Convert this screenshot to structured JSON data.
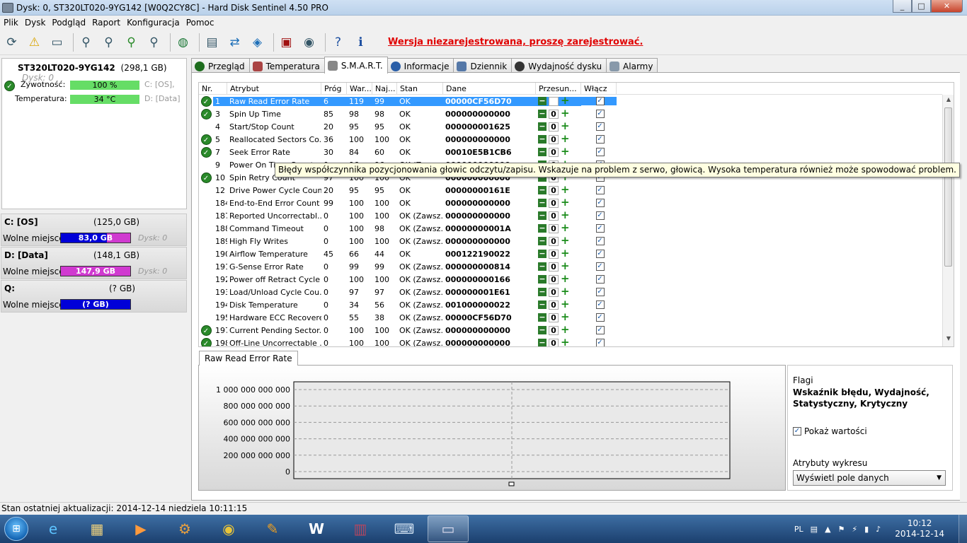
{
  "window": {
    "title": "Dysk: 0, ST320LT020-9YG142 [W0Q2CY8C]  -  Hard Disk Sentinel 4.50 PRO",
    "minimize": "_",
    "maximize": "□",
    "close": "✕"
  },
  "menu": [
    "Plik",
    "Dysk",
    "Podgląd",
    "Raport",
    "Konfiguracja",
    "Pomoc"
  ],
  "toolbar": {
    "icons": [
      "refresh-icon",
      "alert-icon",
      "disk-icon",
      "disk-tool-1-icon",
      "disk-tool-2-icon",
      "disk-tool-3-icon",
      "disk-tool-4-icon",
      "globe-icon",
      "document-icon",
      "sync-icon",
      "network-icon",
      "report-icon",
      "speaker-icon",
      "help-icon",
      "info-icon"
    ],
    "notice": "Wersja niezarejestrowana, proszę zarejestrować."
  },
  "disk": {
    "name": "ST320LT020-9YG142",
    "size": "(298,1 GB)",
    "dnum": "Dysk: 0",
    "health_label": "Żywotność:",
    "health_value": "100 %",
    "health_pct": 100,
    "health_part": "C: [OS],",
    "temp_label": "Temperatura:",
    "temp_value": "34 °C",
    "temp_part": "D: [Data]"
  },
  "partitions": [
    {
      "name": "C: [OS]",
      "size": "(125,0 GB)",
      "free_label": "Wolne miejsce",
      "free": "83,0 GB",
      "used_fraction": 0.34,
      "disk": "Dysk: 0"
    },
    {
      "name": "D: [Data]",
      "size": "(148,1 GB)",
      "free_label": "Wolne miejsce",
      "free": "147,9 GB",
      "used_fraction": 1.0,
      "disk": "Dysk: 0"
    },
    {
      "name": "Q:",
      "size": "(? GB)",
      "free_label": "Wolne miejsce",
      "free": "(? GB)",
      "used_fraction": 0,
      "disk": ""
    }
  ],
  "tabs": [
    "Przegląd",
    "Temperatura",
    "S.M.A.R.T.",
    "Informacje",
    "Dziennik",
    "Wydajność dysku",
    "Alarmy"
  ],
  "active_tab": "S.M.A.R.T.",
  "smart": {
    "headers": [
      "Nr.",
      "Atrybut",
      "Próg",
      "War...",
      "Naj...",
      "Stan",
      "Dane",
      "Przesun...",
      "Włącz"
    ],
    "rows": [
      {
        "ok": true,
        "nr": "1",
        "attr": "Raw Read Error Rate",
        "thr": "6",
        "val": "119",
        "worst": "99",
        "stan": "OK",
        "data": "00000CF56D70",
        "offset": "0",
        "sel": true
      },
      {
        "ok": true,
        "nr": "3",
        "attr": "Spin Up Time",
        "thr": "85",
        "val": "98",
        "worst": "98",
        "stan": "OK",
        "data": "000000000000",
        "offset": "0"
      },
      {
        "ok": false,
        "nr": "4",
        "attr": "Start/Stop Count",
        "thr": "20",
        "val": "95",
        "worst": "95",
        "stan": "OK",
        "data": "000000001625",
        "offset": "0"
      },
      {
        "ok": true,
        "nr": "5",
        "attr": "Reallocated Sectors Co...",
        "thr": "36",
        "val": "100",
        "worst": "100",
        "stan": "OK",
        "data": "000000000000",
        "offset": "0"
      },
      {
        "ok": true,
        "nr": "7",
        "attr": "Seek Error Rate",
        "thr": "30",
        "val": "84",
        "worst": "60",
        "stan": "OK",
        "data": "00010E5B1CB6",
        "offset": "0"
      },
      {
        "ok": false,
        "nr": "9",
        "attr": "Power On Time Count",
        "thr": "0",
        "val": "96",
        "worst": "96",
        "stan": "OK (Zawsz...",
        "data": "000000000000",
        "offset": "0"
      },
      {
        "ok": true,
        "nr": "10",
        "attr": "Spin Retry Count",
        "thr": "97",
        "val": "100",
        "worst": "100",
        "stan": "OK",
        "data": "000000000000",
        "offset": "0"
      },
      {
        "ok": false,
        "nr": "12",
        "attr": "Drive Power Cycle Count",
        "thr": "20",
        "val": "95",
        "worst": "95",
        "stan": "OK",
        "data": "00000000161E",
        "offset": "0"
      },
      {
        "ok": false,
        "nr": "184",
        "attr": "End-to-End Error Count",
        "thr": "99",
        "val": "100",
        "worst": "100",
        "stan": "OK",
        "data": "000000000000",
        "offset": "0"
      },
      {
        "ok": false,
        "nr": "187",
        "attr": "Reported Uncorrectabl...",
        "thr": "0",
        "val": "100",
        "worst": "100",
        "stan": "OK (Zawsz...",
        "data": "000000000000",
        "offset": "0"
      },
      {
        "ok": false,
        "nr": "188",
        "attr": "Command Timeout",
        "thr": "0",
        "val": "100",
        "worst": "98",
        "stan": "OK (Zawsz...",
        "data": "00000000001A",
        "offset": "0"
      },
      {
        "ok": false,
        "nr": "189",
        "attr": "High Fly Writes",
        "thr": "0",
        "val": "100",
        "worst": "100",
        "stan": "OK (Zawsz...",
        "data": "000000000000",
        "offset": "0"
      },
      {
        "ok": false,
        "nr": "190",
        "attr": "Airflow Temperature",
        "thr": "45",
        "val": "66",
        "worst": "44",
        "stan": "OK",
        "data": "000122190022",
        "offset": "0"
      },
      {
        "ok": false,
        "nr": "191",
        "attr": "G-Sense Error Rate",
        "thr": "0",
        "val": "99",
        "worst": "99",
        "stan": "OK (Zawsz...",
        "data": "000000000814",
        "offset": "0"
      },
      {
        "ok": false,
        "nr": "192",
        "attr": "Power off Retract Cycle ...",
        "thr": "0",
        "val": "100",
        "worst": "100",
        "stan": "OK (Zawsz...",
        "data": "000000000166",
        "offset": "0"
      },
      {
        "ok": false,
        "nr": "193",
        "attr": "Load/Unload Cycle Cou...",
        "thr": "0",
        "val": "97",
        "worst": "97",
        "stan": "OK (Zawsz...",
        "data": "000000001E61",
        "offset": "0"
      },
      {
        "ok": false,
        "nr": "194",
        "attr": "Disk Temperature",
        "thr": "0",
        "val": "34",
        "worst": "56",
        "stan": "OK (Zawsz...",
        "data": "001000000022",
        "offset": "0"
      },
      {
        "ok": false,
        "nr": "195",
        "attr": "Hardware ECC Recovered",
        "thr": "0",
        "val": "55",
        "worst": "38",
        "stan": "OK (Zawsz...",
        "data": "00000CF56D70",
        "offset": "0"
      },
      {
        "ok": true,
        "nr": "197",
        "attr": "Current Pending Sector...",
        "thr": "0",
        "val": "100",
        "worst": "100",
        "stan": "OK (Zawsz...",
        "data": "000000000000",
        "offset": "0"
      },
      {
        "ok": true,
        "nr": "198",
        "attr": "Off-Line Uncorrectable ...",
        "thr": "0",
        "val": "100",
        "worst": "100",
        "stan": "OK (Zawsz...",
        "data": "000000000000",
        "offset": "0"
      }
    ]
  },
  "tooltip": "Błędy współczynnika pozycjonowania głowic odczytu/zapisu. Wskazuje na problem z serwo, głowicą. Wysoka temperatura również może spowodować problem.",
  "chart": {
    "tab": "Raw Read Error Rate",
    "yticks": [
      "1 000 000 000 000",
      "800 000 000 000",
      "600 000 000 000",
      "400 000 000 000",
      "200 000 000 000",
      "0"
    ]
  },
  "side": {
    "flags_label": "Flagi",
    "flags_value": "Wskaźnik błędu, Wydajność, Statystyczny, Krytyczny",
    "show_values": "Pokaż wartości",
    "attr_label": "Atrybuty wykresu",
    "dropdown": "Wyświetl pole danych"
  },
  "status": "Stan ostatniej aktualizacji: 2014-12-14 niedziela 10:11:15",
  "taskbar": {
    "apps": [
      "internet-explorer-icon",
      "explorer-icon",
      "media-player-icon",
      "installer-icon",
      "chrome-icon",
      "tool-icon",
      "word-icon",
      "winrar-icon",
      "keyboard-icon",
      "hdsentinel-icon"
    ],
    "lang": "PL",
    "time": "10:12",
    "date": "2014-12-14"
  }
}
